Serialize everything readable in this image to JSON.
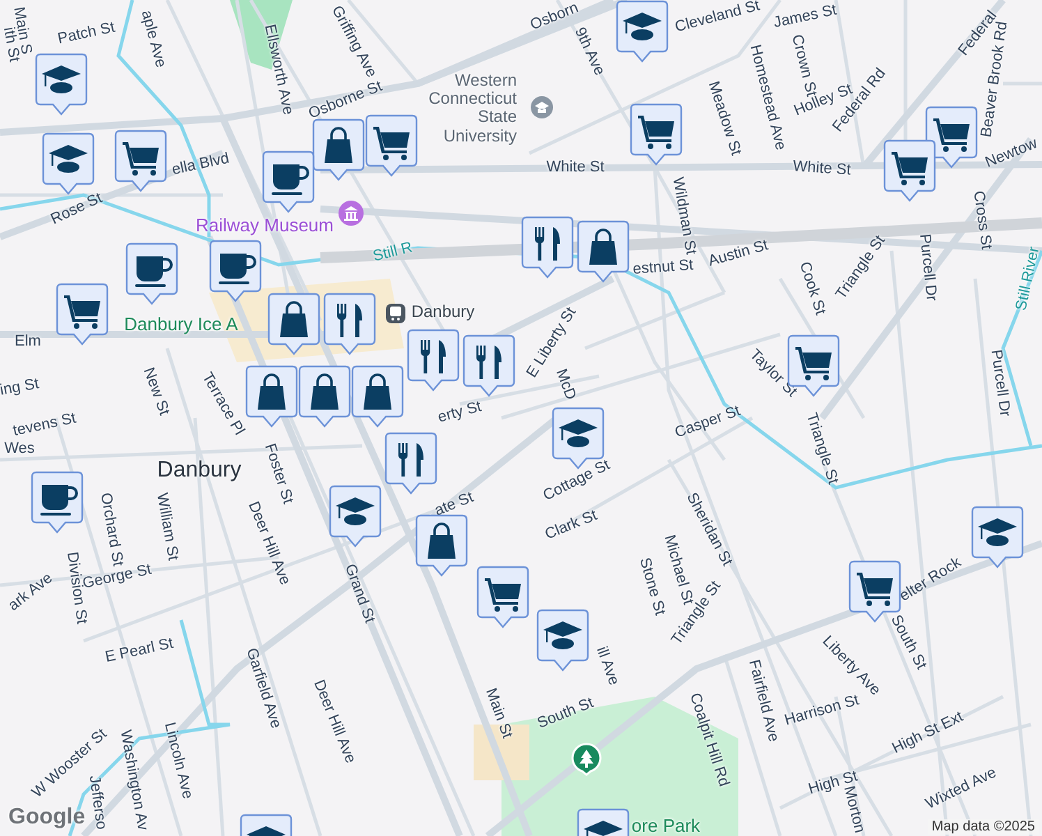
{
  "map": {
    "streets": [
      "ith St",
      "Main S",
      "Patch St",
      "aple Ave",
      "Ellsworth Ave",
      "Griffing Ave",
      "Osborne St",
      "Osborn",
      "Cleveland St",
      "James St",
      "9th Ave",
      "Meadow St",
      "Homestead Ave",
      "Crown St",
      "Holley St",
      "Federal Rd",
      "Federal",
      "Beaver Brook Rd",
      "White St",
      "White St",
      "Newtow",
      "ella Blvd",
      "Rose St",
      "Wildman St",
      "Austin St",
      "estnut St",
      "Cook St",
      "Triangle St",
      "Purcell Dr",
      "Cross St",
      "Purcell Dr",
      "Taylor St",
      "Casper St",
      "Triangle St",
      "E Liberty St",
      "McD",
      "Elm",
      "ing St",
      "New St",
      "Terrace Pl",
      "tevens St",
      "Wes",
      "Foster St",
      "Orchard St",
      "William St",
      "Deer Hill Ave",
      "Deer Hill Ave",
      "Grand St",
      "George St",
      "ark Ave",
      "Division St",
      "E Pearl St",
      "Garfield Ave",
      "W Wooster St",
      "Washington Av",
      "Lincoln Ave",
      "Jefferso",
      "Main St",
      "ate St",
      "erty St",
      "Cottage St",
      "Clark St",
      "Sheridan St",
      "Michael St",
      "Stone St",
      "Triangle St",
      "ill Ave",
      "South St",
      "South St",
      "Coalpit Hill Rd",
      "Fairfield Ave",
      "Liberty Ave",
      "Harrison St",
      "High St Ext",
      "High St",
      "Wixted Ave",
      "Morton",
      "elter Rock"
    ],
    "places": [
      {
        "kind": "university",
        "name": "Western Connecticut State University"
      },
      {
        "kind": "museum",
        "name": "Railway Museum"
      },
      {
        "kind": "station",
        "name": "Danbury"
      },
      {
        "kind": "arena",
        "name": "Danbury Ice A"
      },
      {
        "kind": "town",
        "name": "Danbury"
      },
      {
        "kind": "park",
        "name": "ore Park"
      },
      {
        "kind": "river",
        "name": "Still R"
      },
      {
        "kind": "river",
        "name": "Still River"
      }
    ],
    "pins": [
      {
        "kind": "school"
      },
      {
        "kind": "school"
      },
      {
        "kind": "cart"
      },
      {
        "kind": "bag"
      },
      {
        "kind": "cart"
      },
      {
        "kind": "cup"
      },
      {
        "kind": "cup"
      },
      {
        "kind": "cup"
      },
      {
        "kind": "cart"
      },
      {
        "kind": "school"
      },
      {
        "kind": "cart"
      },
      {
        "kind": "cart"
      },
      {
        "kind": "cart"
      },
      {
        "kind": "fork"
      },
      {
        "kind": "bag"
      },
      {
        "kind": "cart"
      },
      {
        "kind": "school"
      },
      {
        "kind": "cup"
      },
      {
        "kind": "bag"
      },
      {
        "kind": "bag"
      },
      {
        "kind": "bag"
      },
      {
        "kind": "fork"
      },
      {
        "kind": "fork"
      },
      {
        "kind": "fork"
      },
      {
        "kind": "bag"
      },
      {
        "kind": "fork"
      },
      {
        "kind": "school"
      },
      {
        "kind": "bag"
      },
      {
        "kind": "cart"
      },
      {
        "kind": "school"
      },
      {
        "kind": "cart"
      },
      {
        "kind": "school"
      },
      {
        "kind": "school"
      },
      {
        "kind": "school"
      }
    ]
  },
  "logo": "Google",
  "attribution": "Map data ©2025"
}
